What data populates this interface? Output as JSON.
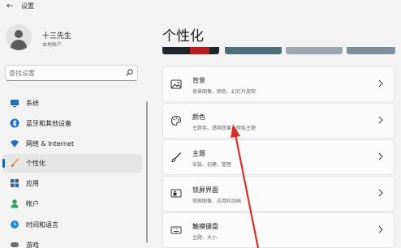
{
  "window": {
    "title": "设置"
  },
  "profile": {
    "name": "十三先生",
    "account_type": "本地帐户"
  },
  "search": {
    "placeholder": "查找设置"
  },
  "sidebar": {
    "items": [
      {
        "label": "系统",
        "icon": "monitor-icon"
      },
      {
        "label": "蓝牙和其他设备",
        "icon": "bluetooth-icon"
      },
      {
        "label": "网络 & Internet",
        "icon": "wifi-icon"
      },
      {
        "label": "个性化",
        "icon": "brush-icon",
        "active": true
      },
      {
        "label": "应用",
        "icon": "apps-icon"
      },
      {
        "label": "帐户",
        "icon": "person-icon"
      },
      {
        "label": "时间和语言",
        "icon": "globe-clock-icon"
      },
      {
        "label": "游戏",
        "icon": "gamepad-icon"
      }
    ]
  },
  "main": {
    "title": "个性化",
    "cards": [
      {
        "title": "背景",
        "description": "背景图像、颜色、幻灯片放映",
        "icon": "image-icon"
      },
      {
        "title": "颜色",
        "description": "主题色、透明效果、颜色主题",
        "icon": "palette-icon"
      },
      {
        "title": "主题",
        "description": "安装、创建、管理",
        "icon": "brush-icon"
      },
      {
        "title": "锁屏界面",
        "description": "锁屏图像、应用和动画",
        "icon": "lock-screen-icon"
      },
      {
        "title": "触摸键盘",
        "description": "主题、大小",
        "icon": "keyboard-icon"
      }
    ]
  },
  "colors": {
    "accent": "#0067c0",
    "annotation": "#d9302a"
  }
}
